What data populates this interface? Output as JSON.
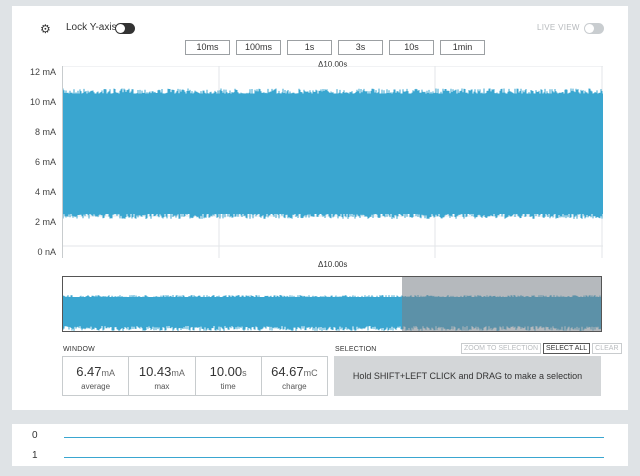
{
  "toolbar": {
    "lock_label": "Lock Y-axis",
    "live_label": "LIVE VIEW",
    "time_buttons": [
      "10ms",
      "100ms",
      "1s",
      "3s",
      "10s",
      "1min"
    ]
  },
  "chart": {
    "delta_top": "Δ10.00s",
    "delta_bottom": "Δ10.00s",
    "y_ticks": [
      "12 mA",
      "10 mA",
      "8 mA",
      "6 mA",
      "4 mA",
      "2 mA",
      "0 nA"
    ],
    "trace_color": "#3aa6d0"
  },
  "chart_data": {
    "type": "area",
    "title": "",
    "xlabel": "",
    "ylabel": "",
    "ylim": [
      0,
      12
    ],
    "y_unit": "mA",
    "duration_s": 10.0,
    "band_min_mA": 2.0,
    "band_max_mA": 10.3,
    "color": "#3aa6d0"
  },
  "window": {
    "label": "WINDOW",
    "stats": [
      {
        "value": "6.47",
        "unit": "mA",
        "caption": "average"
      },
      {
        "value": "10.43",
        "unit": "mA",
        "caption": "max"
      },
      {
        "value": "10.00",
        "unit": "s",
        "caption": "time"
      },
      {
        "value": "64.67",
        "unit": "mC",
        "caption": "charge"
      }
    ]
  },
  "selection": {
    "label": "SELECTION",
    "zoom": "ZOOM TO SELECTION",
    "select_all": "SELECT ALL",
    "clear": "CLEAR",
    "hint": "Hold SHIFT+LEFT CLICK and DRAG to make a selection"
  },
  "channels": [
    "0",
    "1"
  ]
}
